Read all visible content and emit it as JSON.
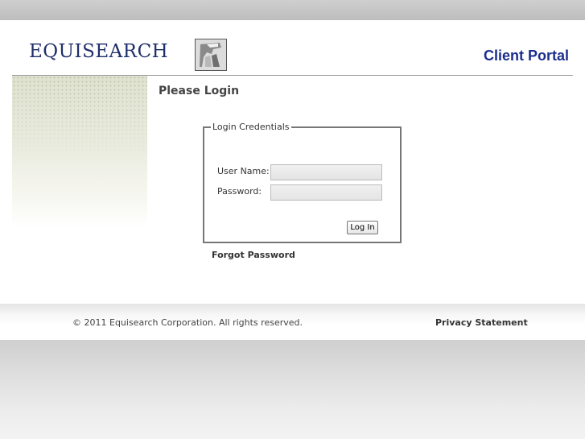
{
  "header": {
    "logo_text": "EQUISEARCH",
    "title": "Client Portal"
  },
  "main": {
    "heading": "Please Login",
    "fieldset_legend": "Login Credentials",
    "username_label": "User Name:",
    "username_value": "",
    "password_label": "Password:",
    "password_value": "",
    "login_button": "Log In",
    "forgot_link": "Forgot Password"
  },
  "footer": {
    "copyright": "© 2011 Equisearch Corporation. All rights reserved.",
    "privacy_link": "Privacy Statement"
  },
  "colors": {
    "brand_blue": "#1c2e8c",
    "logo_navy": "#1f2f6a"
  },
  "icons": {
    "logo_mark": "logo-mark-icon"
  }
}
